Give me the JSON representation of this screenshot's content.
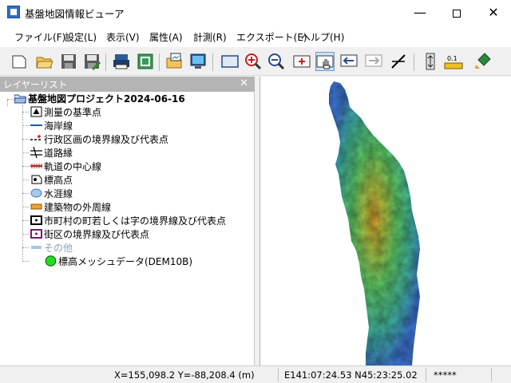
{
  "window": {
    "title": "基盤地図情報ビューア",
    "minimize_glyph": "—",
    "close_glyph": "✕"
  },
  "menu": [
    {
      "label": "ファイル(F)"
    },
    {
      "label": "設定(L)"
    },
    {
      "label": "表示(V)"
    },
    {
      "label": "属性(A)"
    },
    {
      "label": "計測(R)"
    },
    {
      "label": "エクスポート(E)"
    },
    {
      "label": "ヘルプ(H)"
    }
  ],
  "toolbar": {
    "icons": [
      "new-file-icon",
      "open-folder-icon",
      "save-icon",
      "save-as-icon",
      "print-icon",
      "print-setup-icon",
      "export-image-icon",
      "display-icon",
      "fit-window-icon",
      "zoom-in-icon",
      "zoom-out-icon",
      "zoom-rect-icon",
      "pan-hand-icon",
      "previous-view-icon",
      "next-view-icon",
      "measure-distance-icon",
      "vertical-exaggeration-icon",
      "scale-icon",
      "paint-icon"
    ],
    "scale_text": "0.1"
  },
  "panel": {
    "title": "レイヤーリスト",
    "close_glyph": "✕",
    "project": "基盤地図プロジェクト2024-06-16",
    "layers": [
      {
        "label": "測量の基準点",
        "icon": "survey-point-icon"
      },
      {
        "label": "海岸線",
        "icon": "coastline-icon"
      },
      {
        "label": "行政区画の境界線及び代表点",
        "icon": "admin-boundary-icon"
      },
      {
        "label": "道路縁",
        "icon": "road-edge-icon"
      },
      {
        "label": "軌道の中心線",
        "icon": "railway-icon"
      },
      {
        "label": "標高点",
        "icon": "elevation-point-icon"
      },
      {
        "label": "水涯線",
        "icon": "waterline-icon"
      },
      {
        "label": "建築物の外周線",
        "icon": "building-icon"
      },
      {
        "label": "市町村の町若しくは字の境界線及び代表点",
        "icon": "town-boundary-icon"
      },
      {
        "label": "街区の境界線及び代表点",
        "icon": "block-boundary-icon"
      },
      {
        "label": "その他",
        "icon": "other-icon",
        "disabled": true
      },
      {
        "label": "標高メッシュデータ(DEM10B)",
        "icon": "dem-mesh-icon"
      }
    ]
  },
  "status": {
    "xy": "X=155,098.2 Y=-88,208.4 (m)",
    "lonlat": "E141:07:24.53 N45:23:25.02",
    "extra": "*****"
  },
  "colors": {
    "panel_header": "#b4b4b4",
    "dem_low": "#3f78d8",
    "dem_mid": "#5fd06a",
    "dem_high": "#e0a030"
  }
}
